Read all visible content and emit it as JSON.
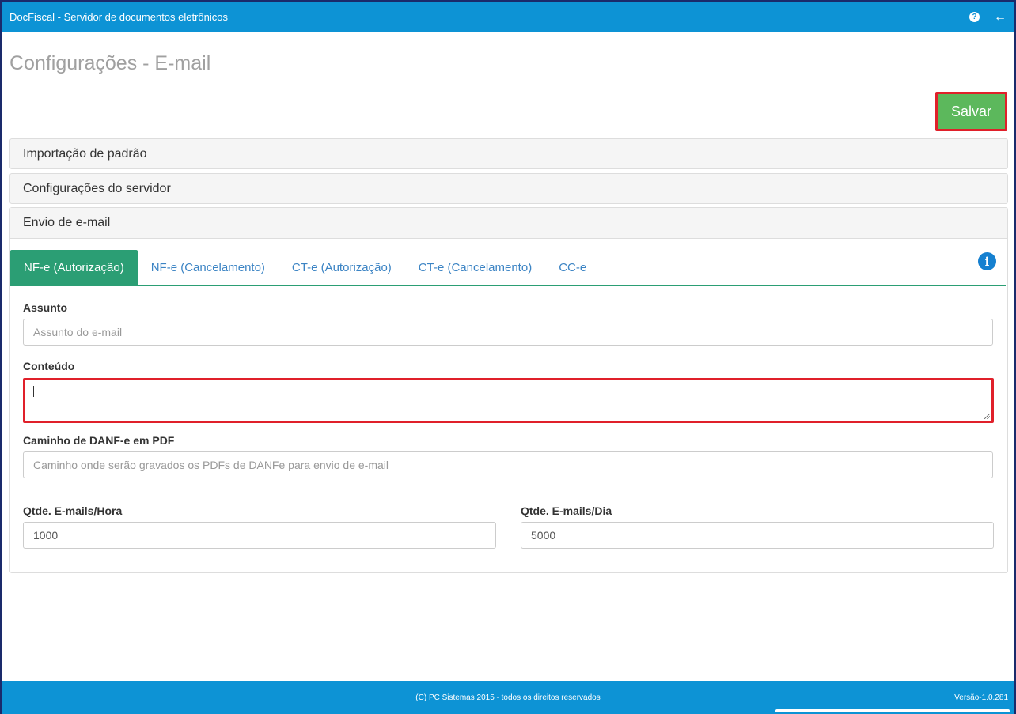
{
  "app": {
    "title": "DocFiscal - Servidor de documentos eletrônicos"
  },
  "header": {
    "help_icon": "question-circle-icon",
    "back_icon": "arrow-left-icon"
  },
  "page": {
    "title": "Configurações - E-mail"
  },
  "toolbar": {
    "save_label": "Salvar"
  },
  "panels": {
    "import": "Importação de padrão",
    "server": "Configurações do servidor",
    "email": "Envio de e-mail"
  },
  "tabs": [
    "NF-e (Autorização)",
    "NF-e (Cancelamento)",
    "CT-e (Autorização)",
    "CT-e (Cancelamento)",
    "CC-e"
  ],
  "info_icon": "i",
  "form": {
    "subject_label": "Assunto",
    "subject_placeholder": "Assunto do e-mail",
    "content_label": "Conteúdo",
    "content_value": "",
    "pdf_path_label": "Caminho de DANF-e em PDF",
    "pdf_path_placeholder": "Caminho onde serão gravados os PDFs de DANFe para envio de e-mail",
    "per_hour_label": "Qtde. E-mails/Hora",
    "per_hour_value": "1000",
    "per_day_label": "Qtde. E-mails/Dia",
    "per_day_value": "5000"
  },
  "footer": {
    "copyright": "(C) PC Sistemas 2015 - todos os direitos reservados",
    "version": "Versão-1.0.281"
  },
  "colors": {
    "topbar": "#0d93d5",
    "active_tab": "#2b9e74",
    "save_button": "#5cb85c",
    "highlight": "#e0202a"
  }
}
